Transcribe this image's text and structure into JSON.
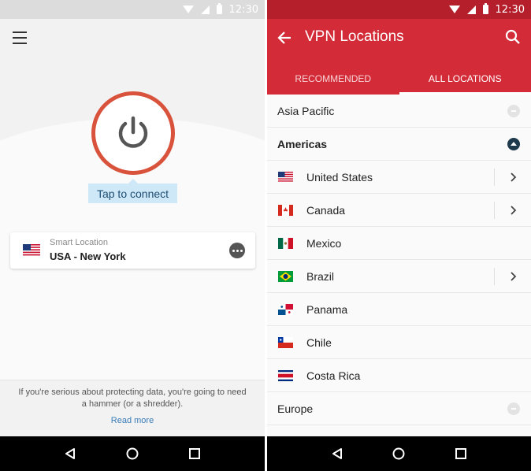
{
  "statusbar": {
    "time": "12:30"
  },
  "home": {
    "tap_label": "Tap to connect",
    "smart_location_label": "Smart Location",
    "location_value": "USA - New York",
    "tip_text": "If you're serious about protecting data, you're going to need a hammer (or a shredder).",
    "read_more": "Read more"
  },
  "locations": {
    "title": "VPN Locations",
    "tabs": [
      {
        "label": "RECOMMENDED",
        "active": false
      },
      {
        "label": "ALL LOCATIONS",
        "active": true
      }
    ],
    "regions": [
      {
        "name": "Asia Pacific",
        "state": "collapsed"
      },
      {
        "name": "Americas",
        "state": "expanded"
      },
      {
        "name": "Europe",
        "state": "collapsed"
      }
    ],
    "countries": [
      {
        "name": "United States",
        "flag": "us-flag-icon",
        "has_children": true
      },
      {
        "name": "Canada",
        "flag": "canada-flag-icon",
        "has_children": true
      },
      {
        "name": "Mexico",
        "flag": "mexico-flag-icon",
        "has_children": false
      },
      {
        "name": "Brazil",
        "flag": "brazil-flag-icon",
        "has_children": true
      },
      {
        "name": "Panama",
        "flag": "panama-flag-icon",
        "has_children": false
      },
      {
        "name": "Chile",
        "flag": "chile-flag-icon",
        "has_children": false
      },
      {
        "name": "Costa Rica",
        "flag": "costa-rica-flag-icon",
        "has_children": false
      }
    ]
  },
  "colors": {
    "brand_red": "#d32b37",
    "status_red": "#b51f2b",
    "power_ring": "#d9533c",
    "tap_bg": "#cfe8f7",
    "link": "#3a7db8"
  }
}
